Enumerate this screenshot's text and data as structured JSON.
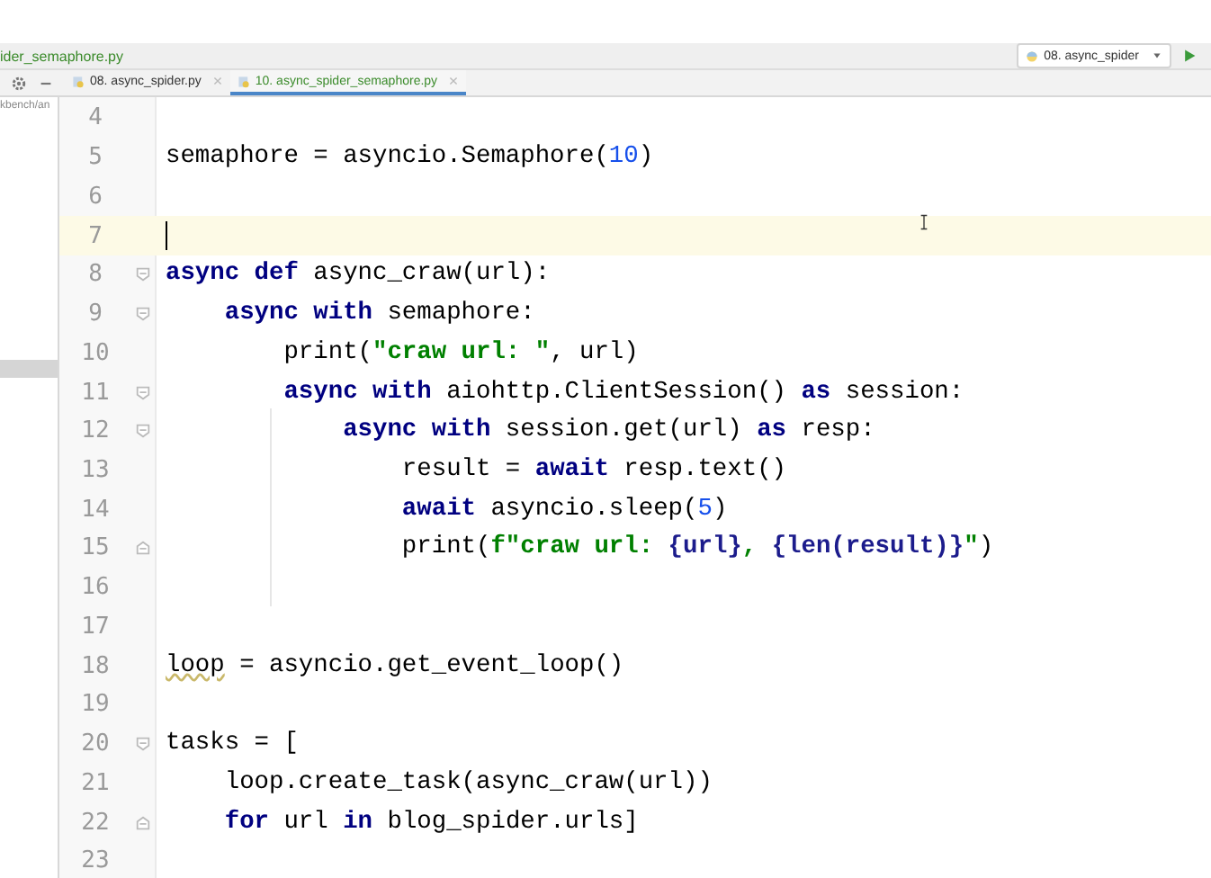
{
  "breadcrumb": "ider_semaphore.py",
  "run_config": {
    "label": "08. async_spider"
  },
  "tabs": [
    {
      "label": "08. async_spider.py",
      "selected": false
    },
    {
      "label": "10. async_spider_semaphore.py",
      "selected": true
    }
  ],
  "project_panel": {
    "path": "kbench/an"
  },
  "code_lines": [
    {
      "number": "4",
      "kind": "plain",
      "current": false
    },
    {
      "number": "5",
      "kind": "plain",
      "current": false,
      "tokens": [
        {
          "text": "semaphore = asyncio.Semaphore(",
          "kind": "plain"
        },
        {
          "text": "10",
          "kind": "number"
        },
        {
          "text": ")",
          "kind": "plain"
        }
      ]
    },
    {
      "number": "6",
      "kind": "plain",
      "current": false
    },
    {
      "number": "7",
      "kind": "plain",
      "current": true
    },
    {
      "number": "8",
      "kind": "foldstart",
      "current": false,
      "tokens": [
        {
          "text": "async def",
          "kind": "keyword"
        },
        {
          "text": " async_craw(url):",
          "kind": "plain"
        }
      ]
    },
    {
      "number": "9",
      "kind": "foldstart",
      "current": false,
      "tokens": [
        {
          "text": "    async with",
          "kind": "keyword"
        },
        {
          "text": " semaphore:",
          "kind": "plain"
        }
      ]
    },
    {
      "number": "10",
      "kind": "plain",
      "current": false,
      "tokens": [
        {
          "text": "        print(",
          "kind": "plain"
        },
        {
          "text": "\"craw url: \"",
          "kind": "string"
        },
        {
          "text": ", url)",
          "kind": "plain"
        }
      ]
    },
    {
      "number": "11",
      "kind": "foldstart",
      "current": false,
      "tokens": [
        {
          "text": "        async with",
          "kind": "keyword"
        },
        {
          "text": " aiohttp.ClientSession() ",
          "kind": "plain"
        },
        {
          "text": "as",
          "kind": "keyword"
        },
        {
          "text": " session:",
          "kind": "plain"
        }
      ]
    },
    {
      "number": "12",
      "kind": "foldstart",
      "current": false,
      "tokens": [
        {
          "text": "            async with",
          "kind": "keyword"
        },
        {
          "text": " session.get(url) ",
          "kind": "plain"
        },
        {
          "text": "as",
          "kind": "keyword"
        },
        {
          "text": " resp:",
          "kind": "plain"
        }
      ]
    },
    {
      "number": "13",
      "kind": "plain",
      "current": false,
      "tokens": [
        {
          "text": "                result = ",
          "kind": "plain"
        },
        {
          "text": "await",
          "kind": "keyword"
        },
        {
          "text": " resp.text()",
          "kind": "plain"
        }
      ]
    },
    {
      "number": "14",
      "kind": "plain",
      "current": false,
      "tokens": [
        {
          "text": "                await",
          "kind": "keyword"
        },
        {
          "text": " asyncio.sleep(",
          "kind": "plain"
        },
        {
          "text": "5",
          "kind": "number"
        },
        {
          "text": ")",
          "kind": "plain"
        }
      ]
    },
    {
      "number": "15",
      "kind": "foldend",
      "current": false,
      "tokens": [
        {
          "text": "                print(",
          "kind": "plain"
        },
        {
          "text": "f\"craw url: ",
          "kind": "string"
        },
        {
          "text": "{url}",
          "kind": "fexpr"
        },
        {
          "text": ", ",
          "kind": "string"
        },
        {
          "text": "{len(result)}",
          "kind": "fexpr"
        },
        {
          "text": "\"",
          "kind": "string"
        },
        {
          "text": ")",
          "kind": "plain"
        }
      ]
    },
    {
      "number": "16",
      "kind": "plain",
      "current": false
    },
    {
      "number": "17",
      "kind": "plain",
      "current": false
    },
    {
      "number": "18",
      "kind": "plain",
      "current": false,
      "tokens": [
        {
          "text": "loop",
          "kind": "warned"
        },
        {
          "text": " = asyncio.get_event_loop()",
          "kind": "plain"
        }
      ]
    },
    {
      "number": "19",
      "kind": "plain",
      "current": false
    },
    {
      "number": "20",
      "kind": "foldstart",
      "current": false,
      "tokens": [
        {
          "text": "tasks = [",
          "kind": "plain"
        }
      ]
    },
    {
      "number": "21",
      "kind": "plain",
      "current": false,
      "tokens": [
        {
          "text": "    loop.create_task(async_craw(url))",
          "kind": "plain"
        }
      ]
    },
    {
      "number": "22",
      "kind": "foldend",
      "current": false,
      "tokens": [
        {
          "text": "    for",
          "kind": "keyword"
        },
        {
          "text": " url ",
          "kind": "plain"
        },
        {
          "text": "in",
          "kind": "keyword"
        },
        {
          "text": " blog_spider.urls]",
          "kind": "plain"
        }
      ]
    },
    {
      "number": "23",
      "kind": "plain",
      "current": false
    }
  ]
}
